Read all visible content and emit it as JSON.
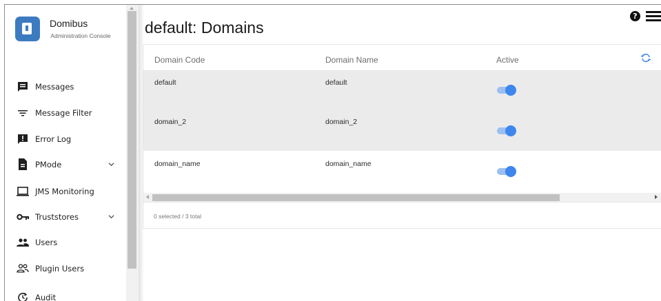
{
  "brand": {
    "title": "Domibus",
    "subtitle": "Administration Console"
  },
  "sidebar": {
    "items": [
      {
        "label": "Messages",
        "icon": "message-icon"
      },
      {
        "label": "Message Filter",
        "icon": "filter-icon"
      },
      {
        "label": "Error Log",
        "icon": "error-log-icon"
      },
      {
        "label": "PMode",
        "icon": "file-icon",
        "expandable": true
      },
      {
        "label": "JMS Monitoring",
        "icon": "monitor-icon"
      },
      {
        "label": "Truststores",
        "icon": "key-icon",
        "expandable": true
      },
      {
        "label": "Users",
        "icon": "users-icon"
      },
      {
        "label": "Plugin Users",
        "icon": "plugin-users-icon"
      },
      {
        "label": "Audit",
        "icon": "audit-icon"
      }
    ]
  },
  "page": {
    "title": "default: Domains"
  },
  "table": {
    "columns": [
      "Domain Code",
      "Domain Name",
      "Active"
    ],
    "rows": [
      {
        "code": "default",
        "name": "default",
        "active": true,
        "selected": true
      },
      {
        "code": "domain_2",
        "name": "domain_2",
        "active": true,
        "selected": true
      },
      {
        "code": "domain_name",
        "name": "domain_name",
        "active": true,
        "selected": false
      }
    ],
    "footer": "0 selected / 3 total"
  },
  "colors": {
    "accent": "#3e86ee",
    "logo": "#3d7bc0",
    "selected_row": "#ebebeb"
  }
}
